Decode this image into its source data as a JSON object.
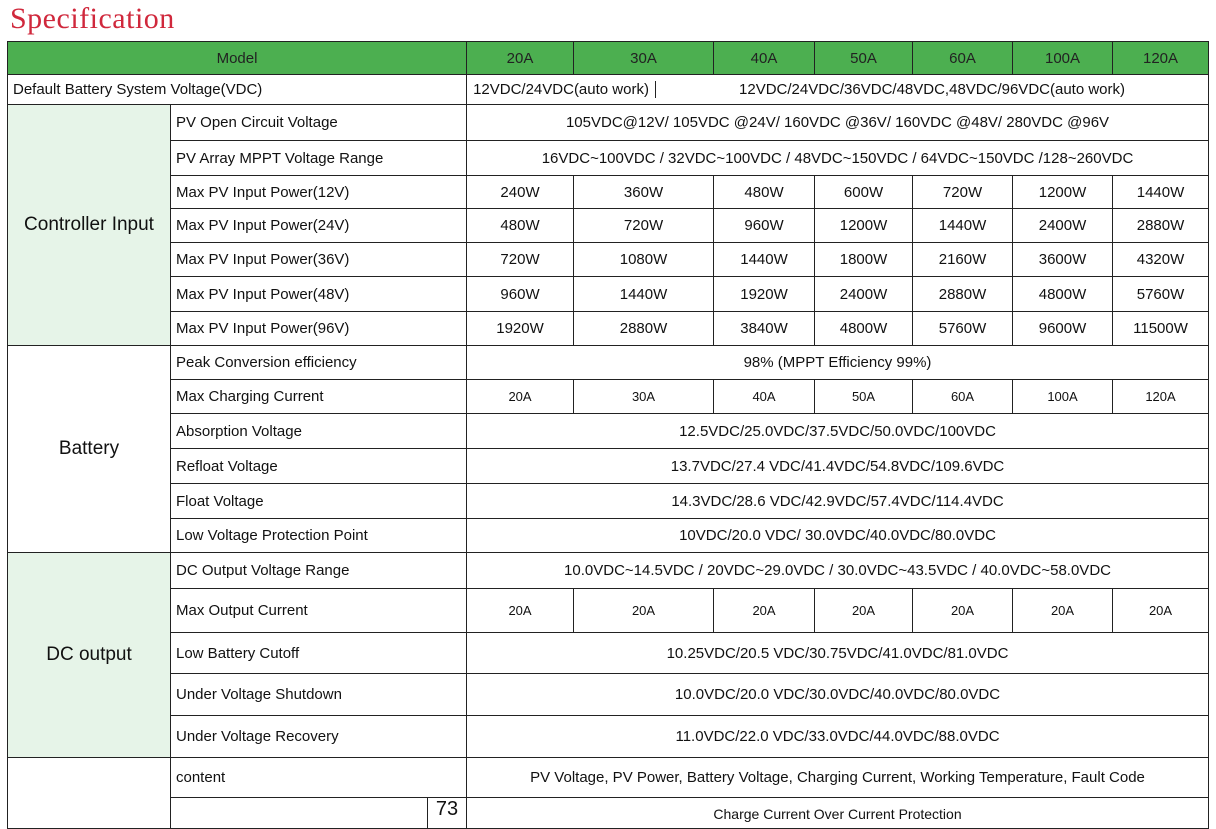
{
  "title": "Specification",
  "header": {
    "label": "Model",
    "models": [
      "20A",
      "30A",
      "40A",
      "50A",
      "60A",
      "100A",
      "120A"
    ]
  },
  "default_row": {
    "label": "Default Battery System Voltage(VDC)",
    "value_20a": "12VDC/24VDC(auto work)",
    "value_rest": "12VDC/24VDC/36VDC/48VDC,48VDC/96VDC(auto work)"
  },
  "groups": [
    {
      "label": "Controller Input",
      "shaded": true,
      "rows": [
        {
          "label": "PV Open Circuit Voltage",
          "span": "105VDC@12V/ 105VDC @24V/ 160VDC @36V/ 160VDC @48V/  280VDC @96V",
          "h": 36
        },
        {
          "label": "PV Array MPPT Voltage Range",
          "span": "16VDC~100VDC / 32VDC~100VDC / 48VDC~150VDC / 64VDC~150VDC /128~260VDC",
          "h": 35
        },
        {
          "label": "Max PV Input Power(12V)",
          "values": [
            "240W",
            "360W",
            "480W",
            "600W",
            "720W",
            "1200W",
            "1440W"
          ],
          "h": 33
        },
        {
          "label": "Max PV Input Power(24V)",
          "values": [
            "480W",
            "720W",
            "960W",
            "1200W",
            "1440W",
            "2400W",
            "2880W"
          ],
          "h": 34
        },
        {
          "label": "Max PV Input Power(36V)",
          "values": [
            "720W",
            "1080W",
            "1440W",
            "1800W",
            "2160W",
            "3600W",
            "4320W"
          ],
          "h": 34
        },
        {
          "label": "Max PV Input Power(48V)",
          "values": [
            "960W",
            "1440W",
            "1920W",
            "2400W",
            "2880W",
            "4800W",
            "5760W"
          ],
          "h": 35
        },
        {
          "label": "Max PV Input Power(96V)",
          "values": [
            "1920W",
            "2880W",
            "3840W",
            "4800W",
            "5760W",
            "9600W",
            "11500W"
          ],
          "h": 34
        }
      ]
    },
    {
      "label": "Battery",
      "shaded": false,
      "rows": [
        {
          "label": "Peak Conversion efficiency",
          "span": "98% (MPPT Efficiency 99%)",
          "h": 34
        },
        {
          "label": "Max Charging Current",
          "values": [
            "20A",
            "30A",
            "40A",
            "50A",
            "60A",
            "100A",
            "120A"
          ],
          "small": true,
          "h": 34
        },
        {
          "label": "Absorption Voltage",
          "span": "12.5VDC/25.0VDC/37.5VDC/50.0VDC/100VDC",
          "h": 35
        },
        {
          "label": "Refloat Voltage",
          "span": "13.7VDC/27.4 VDC/41.4VDC/54.8VDC/109.6VDC",
          "h": 35
        },
        {
          "label": "Float Voltage",
          "span": "14.3VDC/28.6 VDC/42.9VDC/57.4VDC/114.4VDC",
          "h": 35
        },
        {
          "label": "Low Voltage Protection Point",
          "span": "10VDC/20.0 VDC/ 30.0VDC/40.0VDC/80.0VDC",
          "h": 34
        }
      ]
    },
    {
      "label": "DC output",
      "shaded": true,
      "rows": [
        {
          "label": "DC Output Voltage Range",
          "span": "10.0VDC~14.5VDC / 20VDC~29.0VDC / 30.0VDC~43.5VDC / 40.0VDC~58.0VDC",
          "h": 36
        },
        {
          "label": "Max Output Current",
          "values": [
            "20A",
            "20A",
            "20A",
            "20A",
            "20A",
            "20A",
            "20A"
          ],
          "small": true,
          "h": 44
        },
        {
          "label": "Low Battery Cutoff",
          "span": "10.25VDC/20.5 VDC/30.75VDC/41.0VDC/81.0VDC",
          "h": 41
        },
        {
          "label": "Under Voltage Shutdown",
          "span": "10.0VDC/20.0 VDC/30.0VDC/40.0VDC/80.0VDC",
          "h": 42
        },
        {
          "label": "Under Voltage Recovery",
          "span": "11.0VDC/22.0 VDC/33.0VDC/44.0VDC/88.0VDC",
          "h": 42
        }
      ]
    }
  ],
  "display": {
    "content_label": "content",
    "content_value": "PV Voltage, PV Power, Battery Voltage, Charging Current, Working Temperature, Fault Code",
    "page_number": "73",
    "protection_text": "Charge Current Over Current Protection"
  }
}
